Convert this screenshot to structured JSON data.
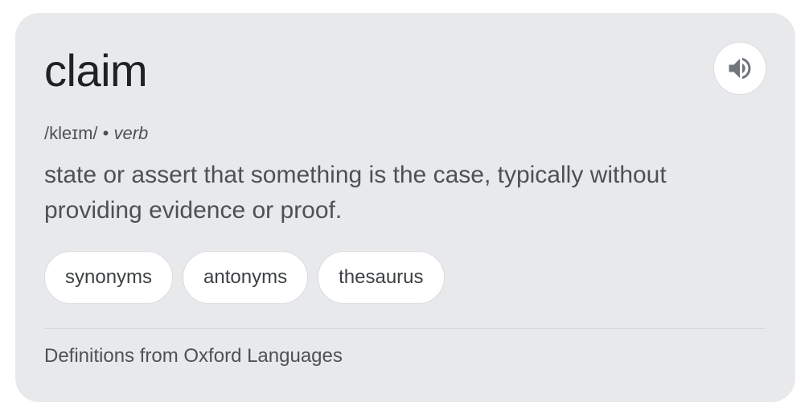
{
  "entry": {
    "word": "claim",
    "phonetic": "/kleɪm/",
    "separator": "•",
    "part_of_speech": "verb",
    "definition": "state or assert that something is the case, typically without providing evidence or proof."
  },
  "audio": {
    "icon": "speaker-icon"
  },
  "chips": [
    {
      "label": "synonyms"
    },
    {
      "label": "antonyms"
    },
    {
      "label": "thesaurus"
    }
  ],
  "footer": {
    "source": "Definitions from Oxford Languages"
  },
  "colors": {
    "card_background": "#e8e9eb",
    "text_primary": "#202124",
    "text_secondary": "#4d5156"
  }
}
